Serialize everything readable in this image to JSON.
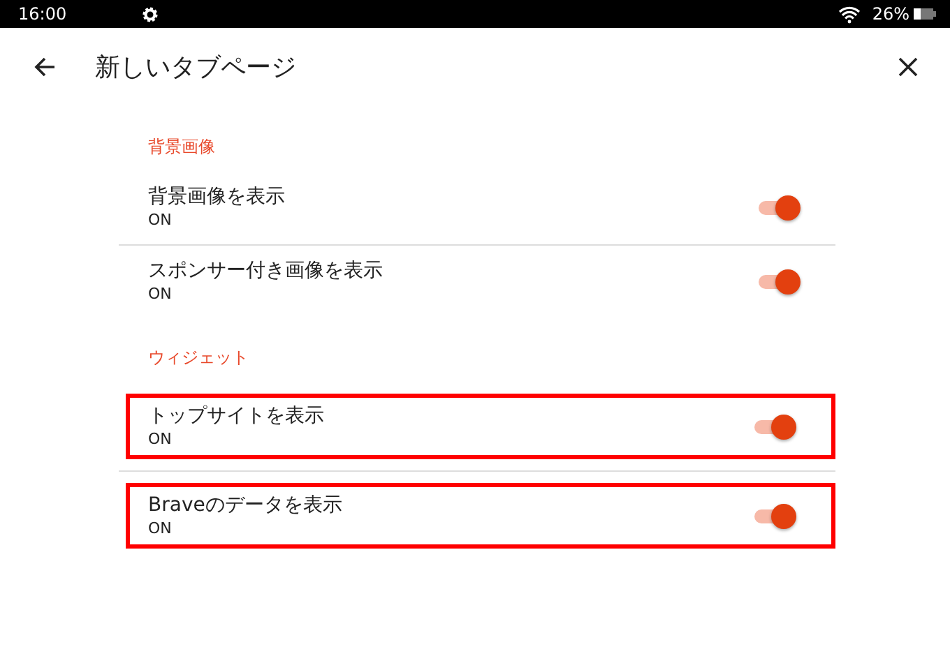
{
  "status_bar": {
    "time": "16:00",
    "battery": "26%"
  },
  "header": {
    "title": "新しいタブページ"
  },
  "sections": [
    {
      "title": "背景画像",
      "items": [
        {
          "title": "背景画像を表示",
          "summary": "ON",
          "on": true,
          "highlighted": false
        },
        {
          "title": "スポンサー付き画像を表示",
          "summary": "ON",
          "on": true,
          "highlighted": false
        }
      ]
    },
    {
      "title": "ウィジェット",
      "items": [
        {
          "title": "トップサイトを表示",
          "summary": "ON",
          "on": true,
          "highlighted": true
        },
        {
          "title": "Braveのデータを表示",
          "summary": "ON",
          "on": true,
          "highlighted": true
        }
      ]
    }
  ]
}
